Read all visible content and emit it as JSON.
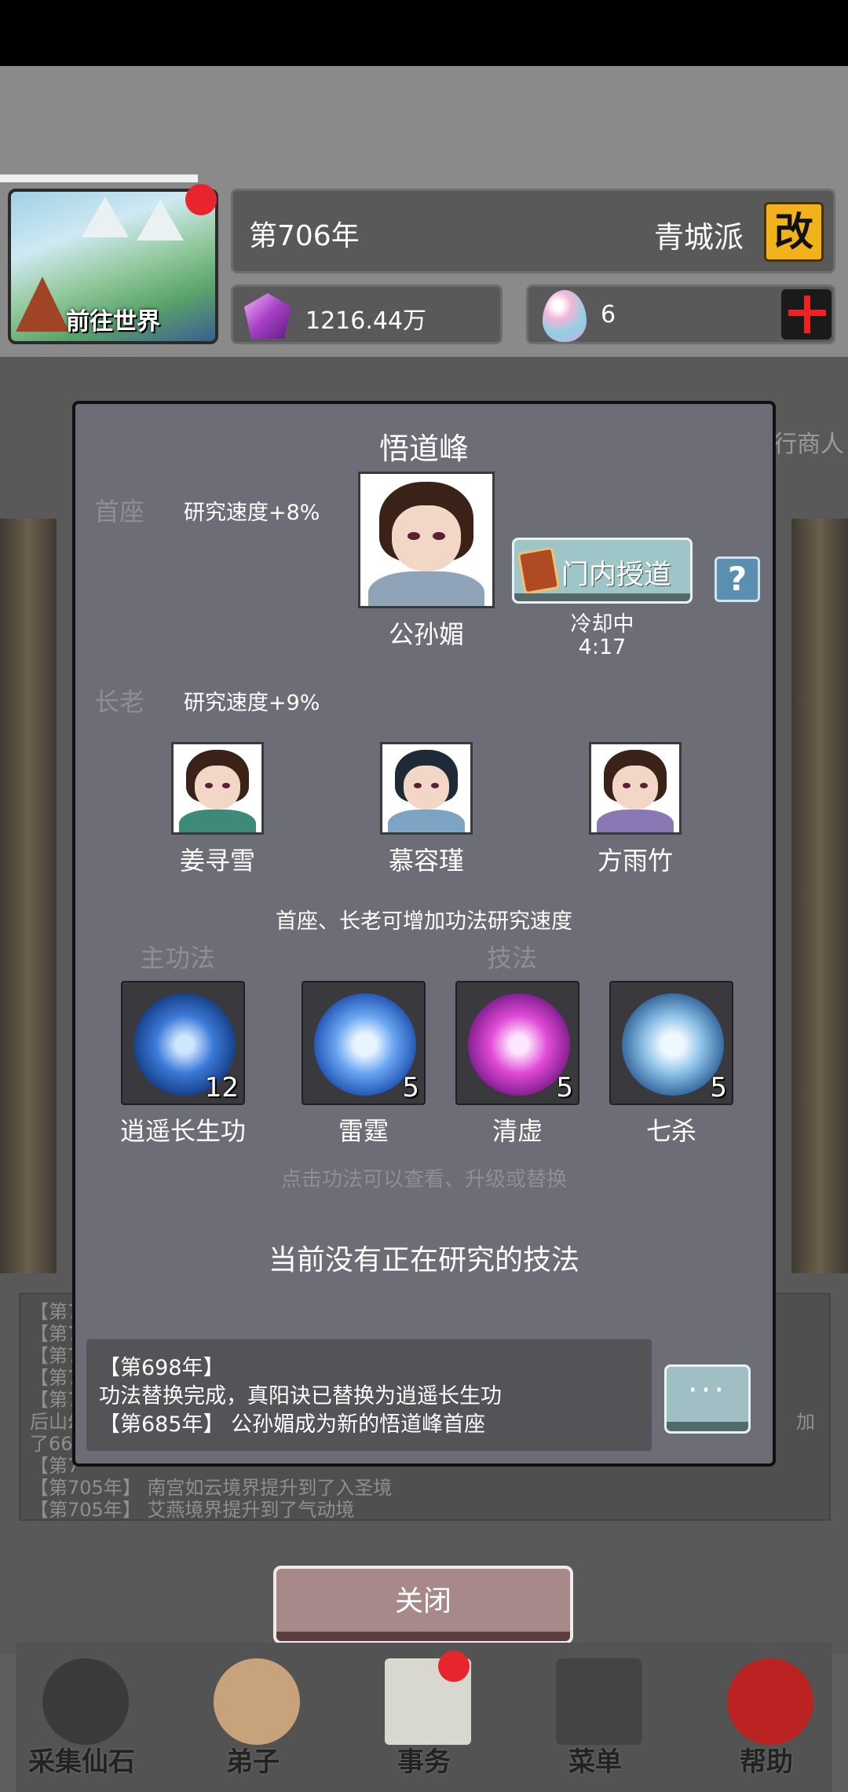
{
  "hud": {
    "world_button_label": "前往世界",
    "year": "第706年",
    "sect_name": "青城派",
    "rename_label": "改",
    "spirit_stone": "1216.44万",
    "egg_count": "6"
  },
  "background": {
    "merchant_fragment": "行商人",
    "log_lines": [
      "【第7",
      "【第7",
      "【第7",
      "【第7",
      "【第7",
      "后山幻",
      "了666",
      "【第7",
      "【第705年】 南宫如云境界提升到了入圣境",
      "【第705年】 艾燕境界提升到了气动境"
    ],
    "log_right_fragment": "加"
  },
  "dialog": {
    "title": "悟道峰",
    "head": {
      "label": "首座",
      "speed": "研究速度+8%",
      "name": "公孙媚"
    },
    "teach_button": "门内授道",
    "help_label": "?",
    "cooldown_label": "冷却中",
    "cooldown_time": "4:17",
    "elders": {
      "label": "长老",
      "speed": "研究速度+9%",
      "members": [
        {
          "name": "姜寻雪"
        },
        {
          "name": "慕容瑾"
        },
        {
          "name": "方雨竹"
        }
      ]
    },
    "info": "首座、长老可增加功法研究速度",
    "main_technique_label": "主功法",
    "skills_label": "技法",
    "skills": [
      {
        "name": "逍遥长生功",
        "level": "12"
      },
      {
        "name": "雷霆",
        "level": "5"
      },
      {
        "name": "清虚",
        "level": "5"
      },
      {
        "name": "七杀",
        "level": "5"
      }
    ],
    "hint": "点击功法可以查看、升级或替换",
    "no_research": "当前没有正在研究的技法",
    "log": [
      "【第698年】",
      "功法替换完成，真阳诀已替换为逍遥长生功",
      "【第685年】 公孙媚成为新的悟道峰首座"
    ],
    "more_label": "···"
  },
  "close_label": "关闭",
  "nav": [
    {
      "label": "采集仙石"
    },
    {
      "label": "弟子"
    },
    {
      "label": "事务"
    },
    {
      "label": "菜单"
    },
    {
      "label": "帮助"
    }
  ]
}
